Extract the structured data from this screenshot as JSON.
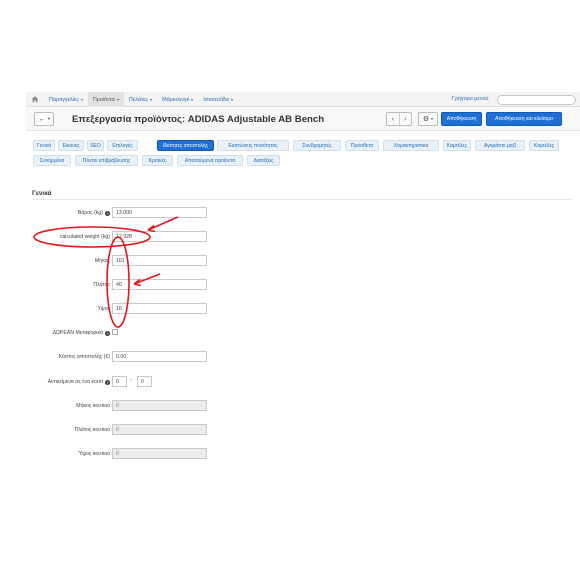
{
  "topbar": {
    "nav": [
      {
        "label": "Παραγγελίες",
        "active": false
      },
      {
        "label": "Προϊόντα",
        "active": true
      },
      {
        "label": "Πελάτες",
        "active": false
      },
      {
        "label": "Μάρκετινγκ",
        "active": false
      },
      {
        "label": "Ιστοσελίδα",
        "active": false
      }
    ],
    "quick_menu": "Γρήγορο μενού",
    "search_placeholder": ""
  },
  "titlebar": {
    "title": "Επεξεργασία προϊόντος: ADIDAS Adjustable AB Bench",
    "save_label": "Αποθήκευση",
    "save_close_label": "Αποθήκευση και κλείσιμο",
    "prev_glyph": "‹",
    "next_glyph": "›",
    "back_glyph": "←",
    "gear_glyph": "⚙"
  },
  "tabs": [
    {
      "label": "Γενικά"
    },
    {
      "label": "Εικόνες"
    },
    {
      "label": "SEO"
    },
    {
      "label": "Επιλογές"
    },
    {
      "label": "Ιδιότητες αποστολής",
      "active": true
    },
    {
      "label": "Εκπτώσεις ποσότητας"
    },
    {
      "label": "Συνδρομητές"
    },
    {
      "label": "Πρόσθετα"
    },
    {
      "label": "Χαρακτηριστικά"
    },
    {
      "label": "Καρτέλες"
    },
    {
      "label": "Αγοράστε μαζί"
    },
    {
      "label": "Καρτέλες"
    },
    {
      "label": "Συνημμένα"
    },
    {
      "label": "Πόντοι επιβράβευσης"
    },
    {
      "label": "Κριτικές"
    },
    {
      "label": "Απαιτούμενα προϊόντα"
    },
    {
      "label": "Διατάξεις"
    }
  ],
  "form": {
    "section_title": "Γενικά",
    "weight": {
      "label": "Βάρος (kg)",
      "value": "13.000"
    },
    "calc_weight": {
      "label": "calculated weight (kg)",
      "value": "12.928"
    },
    "length": {
      "label": "Μήκος",
      "value": "101"
    },
    "width": {
      "label": "Πλάτος",
      "value": "40"
    },
    "height": {
      "label": "Ύψος",
      "value": "16"
    },
    "free_shipping": {
      "label": "ΔΩΡΕΑΝ Μεταφορικά"
    },
    "shipping_cost": {
      "label": "Κόστος αποστολής (€)",
      "value": "0.00"
    },
    "items_per_box": {
      "label": "Αντικείμενα σε ένα κουτί",
      "min": "0",
      "max": "0",
      "dash": "-"
    },
    "box_length": {
      "label": "Μήκος κουτιού",
      "value": "0"
    },
    "box_width": {
      "label": "Πλάτος κουτιού",
      "value": "0"
    },
    "box_height": {
      "label": "Ύψος κουτιού",
      "value": "0"
    }
  },
  "colors": {
    "accent": "#1f6fd6",
    "link": "#2a6bb3",
    "annotation": "#e3161c"
  }
}
